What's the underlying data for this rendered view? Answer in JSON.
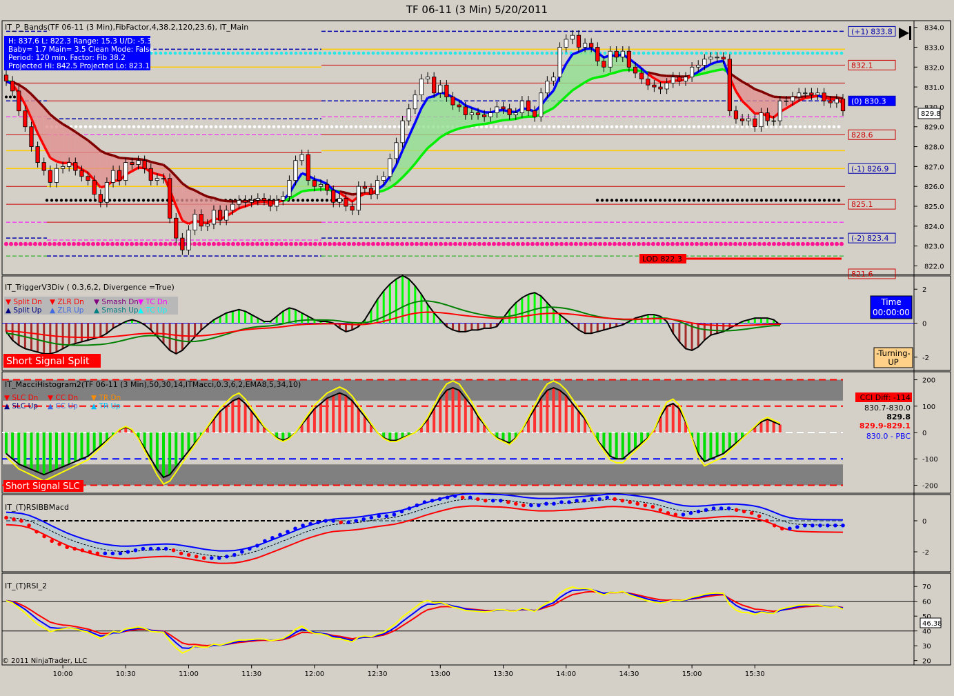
{
  "window": {
    "title": "TF 06-11 (3 Min)  5/20/2011"
  },
  "copyright": "© 2011 NinjaTrader, LLC",
  "colors": {
    "bg": "#d4d0c8",
    "up": "#00cc00",
    "down": "#ff0000",
    "blue": "#0000ff",
    "yellow": "#ffff00",
    "magenta": "#ff00ff"
  },
  "panels": {
    "main": {
      "indicator": "IT_P_Bands(TF 06-11 (3 Min),FibFactor,4,38.2,120,23.6),  IT_Main",
      "infobox": [
        "H: 837.6  L: 822.3  Range: 15.3  U/D: -5.3",
        "Baby= 1.7  Main= 3.5  Clean Mode: False",
        "Period: 120 min.  Factor: Fib 38.2",
        "Projected Hi: 842.5  Projected Lo: 823.1"
      ],
      "level_labels": [
        {
          "text": "(+1) 833.8",
          "y": 833.8,
          "style": "box-blue"
        },
        {
          "text": "832.1",
          "y": 832.1,
          "style": "box-red"
        },
        {
          "text": "(0) 830.3",
          "y": 830.3,
          "style": "fill-blue"
        },
        {
          "text": "828.6",
          "y": 828.6,
          "style": "box-red"
        },
        {
          "text": "(-1) 826.9",
          "y": 826.9,
          "style": "box-blue"
        },
        {
          "text": "825.1",
          "y": 825.1,
          "style": "box-red"
        },
        {
          "text": "(-2) 823.4",
          "y": 823.4,
          "style": "box-blue"
        },
        {
          "text": "821.6",
          "y": 821.6,
          "style": "box-red"
        }
      ],
      "lod_label": "LOD 822.3",
      "last_price": "829.8",
      "y_ticks": [
        "834.0",
        "833.0",
        "832.0",
        "831.0",
        "830.0",
        "829.0",
        "828.0",
        "827.0",
        "826.0",
        "825.0",
        "824.0",
        "823.0",
        "822.0"
      ]
    },
    "trigger": {
      "indicator": "IT_TriggerV3Div ( 0.3,6,2, Divergence =True)",
      "legend": [
        {
          "text": "▼ Split Dn",
          "color": "#ff0000"
        },
        {
          "text": "▼ ZLR Dn",
          "color": "#ff0000"
        },
        {
          "text": "▼ Smash Dn",
          "color": "#800080"
        },
        {
          "text": "▼ TC Dn",
          "color": "#ff00ff"
        },
        {
          "text": "▲ Split Up",
          "color": "#000080"
        },
        {
          "text": "▲ ZLR Up",
          "color": "#4169e1"
        },
        {
          "text": "▲ Smash Up",
          "color": "#008080"
        },
        {
          "text": "▲ TC Up",
          "color": "#00ffff"
        }
      ],
      "signal": "Short Signal  Split",
      "time_label": "Time",
      "time_value": "00:00:00",
      "turning": [
        "-Turning-",
        "UP"
      ],
      "y_ticks": [
        "2",
        "0",
        "-2"
      ]
    },
    "macci": {
      "indicator": "IT_MacciHistogram2(TF 06-11 (3 Min),50,30,14,ITMacci,0.3,6,2,EMA8,5,34,10)",
      "legend": [
        {
          "text": "▼ SLC Dn",
          "color": "#ff0000"
        },
        {
          "text": "▼ CC Dn",
          "color": "#ff0000"
        },
        {
          "text": "▼ TR Dn",
          "color": "#ff8c00"
        },
        {
          "text": "▲ SLC Up",
          "color": "#000080"
        },
        {
          "text": "▲ CC Up",
          "color": "#4169e1"
        },
        {
          "text": "▲ TR Up",
          "color": "#00bfff"
        }
      ],
      "signal": "Short Signal   SLC",
      "cci_diff": "CCI Diff: -114",
      "readouts": [
        {
          "text": "830.7-830.0",
          "color": "#000000"
        },
        {
          "text": "829.8",
          "color": "#000000"
        },
        {
          "text": "829.9-829.1",
          "color": "#ff0000"
        },
        {
          "text": "830.0 - PBC",
          "color": "#0000ff"
        }
      ],
      "y_ticks": [
        "200",
        "100",
        "0",
        "-100",
        "-200"
      ]
    },
    "rsibb": {
      "indicator": "IT_(T)RSIBBMacd",
      "y_ticks": [
        "0",
        "-2"
      ]
    },
    "rsi2": {
      "indicator": "IT_(T)RSI_2",
      "y_ticks": [
        "70",
        "60",
        "50",
        "40",
        "30",
        "20"
      ],
      "last_value": "46.38"
    }
  },
  "x_ticks": [
    "10:00",
    "10:30",
    "11:00",
    "11:30",
    "12:00",
    "12:30",
    "13:00",
    "13:30",
    "14:00",
    "14:30",
    "15:00",
    "15:30"
  ],
  "chart_data": [
    {
      "type": "candlestick",
      "title": "TF 06-11 (3 Min)  5/20/2011",
      "ylim": [
        821.6,
        834.3
      ],
      "x_times": [
        "09:33",
        "09:36",
        "09:39",
        "09:42",
        "09:45",
        "09:48",
        "09:51",
        "09:54",
        "09:57",
        "10:00",
        "10:03",
        "10:06",
        "10:09",
        "10:12",
        "10:15",
        "10:18",
        "10:21",
        "10:24",
        "10:27",
        "10:30",
        "10:33",
        "10:36",
        "10:39",
        "10:42",
        "10:45",
        "10:48",
        "10:51",
        "10:54",
        "10:57",
        "11:00",
        "11:03",
        "11:06",
        "11:09",
        "11:12",
        "11:15",
        "11:18",
        "11:21",
        "11:24",
        "11:27",
        "11:30",
        "11:33",
        "11:36",
        "11:39",
        "11:42",
        "11:45",
        "11:48",
        "11:51",
        "11:54",
        "11:57",
        "12:00",
        "12:03",
        "12:06",
        "12:09",
        "12:12",
        "12:15",
        "12:18",
        "12:21",
        "12:24",
        "12:27",
        "12:30",
        "12:33",
        "12:36",
        "12:39",
        "12:42",
        "12:45",
        "12:48",
        "12:51",
        "12:54",
        "12:57",
        "13:00",
        "13:03",
        "13:06",
        "13:09",
        "13:12",
        "13:15",
        "13:18",
        "13:21",
        "13:24",
        "13:27",
        "13:30",
        "13:33",
        "13:36",
        "13:39",
        "13:42",
        "13:45",
        "13:48",
        "13:51",
        "13:54",
        "13:57",
        "14:00",
        "14:03",
        "14:06",
        "14:09",
        "14:12",
        "14:15",
        "14:18",
        "14:21",
        "14:24",
        "14:27",
        "14:30",
        "14:33",
        "14:36",
        "14:39",
        "14:42",
        "14:45",
        "14:48",
        "14:51",
        "14:54",
        "14:57",
        "15:00",
        "15:03",
        "15:06",
        "15:09",
        "15:12",
        "15:15",
        "15:18",
        "15:21",
        "15:24",
        "15:27",
        "15:30",
        "15:33",
        "15:36",
        "15:39",
        "15:42",
        "15:45"
      ],
      "close": [
        831.3,
        830.8,
        829.8,
        829.0,
        828.0,
        827.2,
        826.8,
        826.2,
        826.9,
        827.0,
        827.2,
        826.8,
        826.5,
        826.3,
        825.6,
        825.2,
        826.2,
        826.8,
        826.3,
        827.2,
        827.1,
        827.3,
        826.9,
        826.3,
        826.4,
        826.4,
        824.4,
        823.4,
        822.8,
        823.8,
        824.6,
        824.0,
        824.1,
        824.8,
        824.3,
        824.8,
        825.1,
        825.3,
        825.2,
        825.3,
        825.4,
        825.3,
        825.0,
        825.3,
        825.5,
        826.3,
        827.3,
        827.6,
        826.3,
        826.0,
        826.1,
        825.8,
        825.2,
        825.4,
        825.0,
        824.8,
        826.0,
        825.9,
        825.6,
        826.3,
        826.5,
        827.4,
        828.2,
        829.3,
        829.9,
        830.6,
        831.4,
        831.5,
        830.7,
        831.1,
        830.5,
        830.1,
        830.0,
        829.6,
        829.7,
        829.6,
        829.5,
        829.7,
        830.0,
        829.9,
        829.6,
        829.7,
        830.3,
        829.8,
        829.5,
        830.7,
        831.3,
        831.5,
        833.0,
        833.4,
        833.6,
        833.0,
        833.2,
        833.0,
        832.3,
        832.0,
        832.8,
        832.5,
        832.8,
        832.0,
        831.7,
        831.4,
        831.1,
        831.0,
        830.9,
        831.2,
        831.5,
        831.3,
        831.5,
        832.0,
        832.1,
        832.4,
        832.5,
        832.5,
        832.4,
        829.8,
        829.4,
        829.3,
        829.4,
        829.0,
        829.7,
        829.3,
        829.3,
        830.3,
        830.3,
        830.5,
        830.7,
        830.7,
        830.6,
        830.7,
        830.3,
        830.2,
        830.4,
        829.8
      ],
      "series": [
        {
          "name": "IT_Main fast",
          "color": "#ff0000"
        },
        {
          "name": "IT_Main slow",
          "color": "#800000"
        },
        {
          "name": "IT_Main fast up",
          "color": "#0000ff"
        },
        {
          "name": "IT_Main slow up",
          "color": "#00ee00"
        }
      ]
    },
    {
      "type": "bar",
      "title": "IT_TriggerV3Div ( 0.3,6,2, Divergence =True)",
      "ylim": [
        -2.7,
        2.7
      ],
      "x_times_ref": "same as panel 1",
      "values": [
        -0.5,
        -1.0,
        -1.3,
        -1.5,
        -1.6,
        -1.7,
        -1.8,
        -1.8,
        -1.7,
        -1.5,
        -1.3,
        -1.2,
        -1.1,
        -1.0,
        -0.9,
        -0.8,
        -0.6,
        -0.3,
        -0.1,
        0.1,
        0.2,
        0.1,
        -0.1,
        -0.4,
        -0.8,
        -1.2,
        -1.6,
        -1.8,
        -1.6,
        -1.2,
        -0.8,
        -0.4,
        -0.1,
        0.2,
        0.4,
        0.6,
        0.7,
        0.8,
        0.7,
        0.5,
        0.3,
        0.1,
        0.1,
        0.4,
        0.7,
        0.9,
        0.8,
        0.6,
        0.4,
        0.2,
        0.1,
        0.1,
        0.0,
        -0.3,
        -0.5,
        -0.4,
        -0.2,
        0.2,
        0.8,
        1.4,
        1.9,
        2.3,
        2.6,
        2.8,
        2.6,
        2.2,
        1.7,
        1.1,
        0.6,
        0.2,
        -0.2,
        -0.4,
        -0.5,
        -0.5,
        -0.4,
        -0.4,
        -0.3,
        -0.3,
        -0.2,
        0.3,
        0.8,
        1.2,
        1.5,
        1.7,
        1.8,
        1.6,
        1.2,
        0.8,
        0.5,
        0.2,
        -0.1,
        -0.4,
        -0.6,
        -0.6,
        -0.5,
        -0.4,
        -0.3,
        -0.2,
        -0.1,
        0.1,
        0.3,
        0.4,
        0.5,
        0.5,
        0.4,
        0.1,
        -0.6,
        -1.1,
        -1.5,
        -1.6,
        -1.4,
        -1.0,
        -0.7,
        -0.6,
        -0.5,
        -0.3,
        -0.1,
        0.1,
        0.2,
        0.3,
        0.3,
        0.3,
        0.2,
        -0.1
      ],
      "series": [
        {
          "name": "Trigger",
          "color": "#000000"
        },
        {
          "name": "Trend fast",
          "color": "#ff0000"
        },
        {
          "name": "Trend slow",
          "color": "#008000"
        }
      ]
    },
    {
      "type": "bar",
      "title": "IT_MacciHistogram2(TF 06-11 (3 Min),50,30,14,ITMacci,0.3,6,2,EMA8,5,34,10)",
      "ylim": [
        -225,
        225
      ],
      "values": [
        -80,
        -100,
        -120,
        -130,
        -140,
        -150,
        -160,
        -150,
        -140,
        -130,
        -120,
        -110,
        -100,
        -90,
        -70,
        -50,
        -30,
        -10,
        10,
        20,
        10,
        -20,
        -60,
        -100,
        -140,
        -170,
        -160,
        -130,
        -100,
        -70,
        -40,
        -10,
        20,
        50,
        80,
        100,
        120,
        130,
        110,
        80,
        50,
        20,
        0,
        -20,
        -30,
        -20,
        0,
        30,
        60,
        90,
        110,
        130,
        140,
        150,
        140,
        120,
        90,
        60,
        30,
        0,
        -20,
        -30,
        -30,
        -20,
        -10,
        0,
        20,
        50,
        90,
        130,
        160,
        170,
        160,
        130,
        100,
        60,
        30,
        0,
        -20,
        -30,
        -40,
        -20,
        10,
        50,
        90,
        130,
        160,
        170,
        160,
        140,
        110,
        80,
        50,
        10,
        -30,
        -60,
        -90,
        -100,
        -100,
        -80,
        -60,
        -40,
        -20,
        10,
        60,
        100,
        110,
        90,
        40,
        -20,
        -80,
        -110,
        -100,
        -90,
        -80,
        -60,
        -40,
        -20,
        0,
        20,
        40,
        50,
        40,
        30
      ],
      "series": [
        {
          "name": "CCI",
          "color": "#000000"
        },
        {
          "name": "Turbo",
          "color": "#ffff00"
        }
      ]
    },
    {
      "type": "line",
      "title": "IT_(T)RSIBBMacd",
      "ylim": [
        -3.2,
        1.6
      ],
      "series": [
        {
          "name": "MACD dots",
          "color": "#0000ff",
          "values": [
            0.2,
            0.1,
            0.0,
            -0.3,
            -0.7,
            -1.0,
            -1.3,
            -1.5,
            -1.7,
            -1.8,
            -1.9,
            -2.0,
            -2.1,
            -2.1,
            -2.1,
            -2.1,
            -2.0,
            -1.9,
            -1.8,
            -1.8,
            -1.8,
            -1.8,
            -1.9,
            -2.1,
            -2.2,
            -2.3,
            -2.4,
            -2.4,
            -2.4,
            -2.3,
            -2.2,
            -2.0,
            -1.8,
            -1.6,
            -1.3,
            -1.1,
            -0.9,
            -0.7,
            -0.5,
            -0.3,
            -0.2,
            -0.1,
            0.0,
            0.0,
            -0.1,
            -0.1,
            0.0,
            0.1,
            0.2,
            0.3,
            0.3,
            0.4,
            0.6,
            0.8,
            1.0,
            1.2,
            1.3,
            1.4,
            1.5,
            1.6,
            1.5,
            1.5,
            1.4,
            1.3,
            1.3,
            1.3,
            1.2,
            1.1,
            1.0,
            1.0,
            1.0,
            1.1,
            1.1,
            1.2,
            1.2,
            1.3,
            1.3,
            1.4,
            1.4,
            1.5,
            1.4,
            1.3,
            1.2,
            1.1,
            1.0,
            0.9,
            0.7,
            0.5,
            0.4,
            0.4,
            0.5,
            0.6,
            0.7,
            0.8,
            0.8,
            0.8,
            0.7,
            0.6,
            0.5,
            0.3,
            0.0,
            -0.3,
            -0.5,
            -0.5,
            -0.4,
            -0.3,
            -0.3,
            -0.3,
            -0.3,
            -0.3,
            -0.3
          ]
        },
        {
          "name": "Signal",
          "color": "#ff0000",
          "values": [
            0.0,
            -0.2,
            -0.5,
            -0.8,
            -1.1,
            -1.4,
            -1.6,
            -1.8,
            -1.9,
            -2.0,
            -2.1,
            -2.1,
            -2.2,
            -2.2,
            -2.2,
            -2.2,
            -2.2,
            -2.2,
            -2.3,
            -2.4,
            -2.5,
            -2.6,
            -2.6,
            -2.6,
            -2.5,
            -2.4,
            -2.3,
            -2.1,
            -1.9,
            -1.7,
            -1.5,
            -1.3,
            -1.1,
            -0.9,
            -0.7,
            -0.5,
            -0.4,
            -0.3,
            -0.1,
            0.0,
            0.2,
            0.4,
            0.6,
            0.9,
            1.1,
            1.3,
            1.4,
            1.4,
            1.4,
            1.3,
            1.3,
            1.2,
            1.2,
            1.1,
            1.1,
            1.2,
            1.2,
            1.3,
            1.3,
            1.3,
            1.3,
            1.2,
            1.1,
            1.0,
            0.9,
            0.8,
            0.7,
            0.7,
            0.7,
            0.6,
            0.5,
            0.4,
            0.2,
            -0.1,
            -0.3,
            -0.4,
            -0.4,
            -0.4,
            -0.3
          ]
        },
        {
          "name": "BB upper",
          "color": "#0000ff"
        },
        {
          "name": "BB lower",
          "color": "#ff0000"
        }
      ]
    },
    {
      "type": "line",
      "title": "IT_(T)RSI_2",
      "ylim": [
        18,
        78
      ],
      "series": [
        {
          "name": "RSI yellow",
          "color": "#ffff00"
        },
        {
          "name": "RSI blue",
          "color": "#0000ff"
        },
        {
          "name": "RSI red",
          "color": "#ff0000"
        }
      ]
    }
  ]
}
